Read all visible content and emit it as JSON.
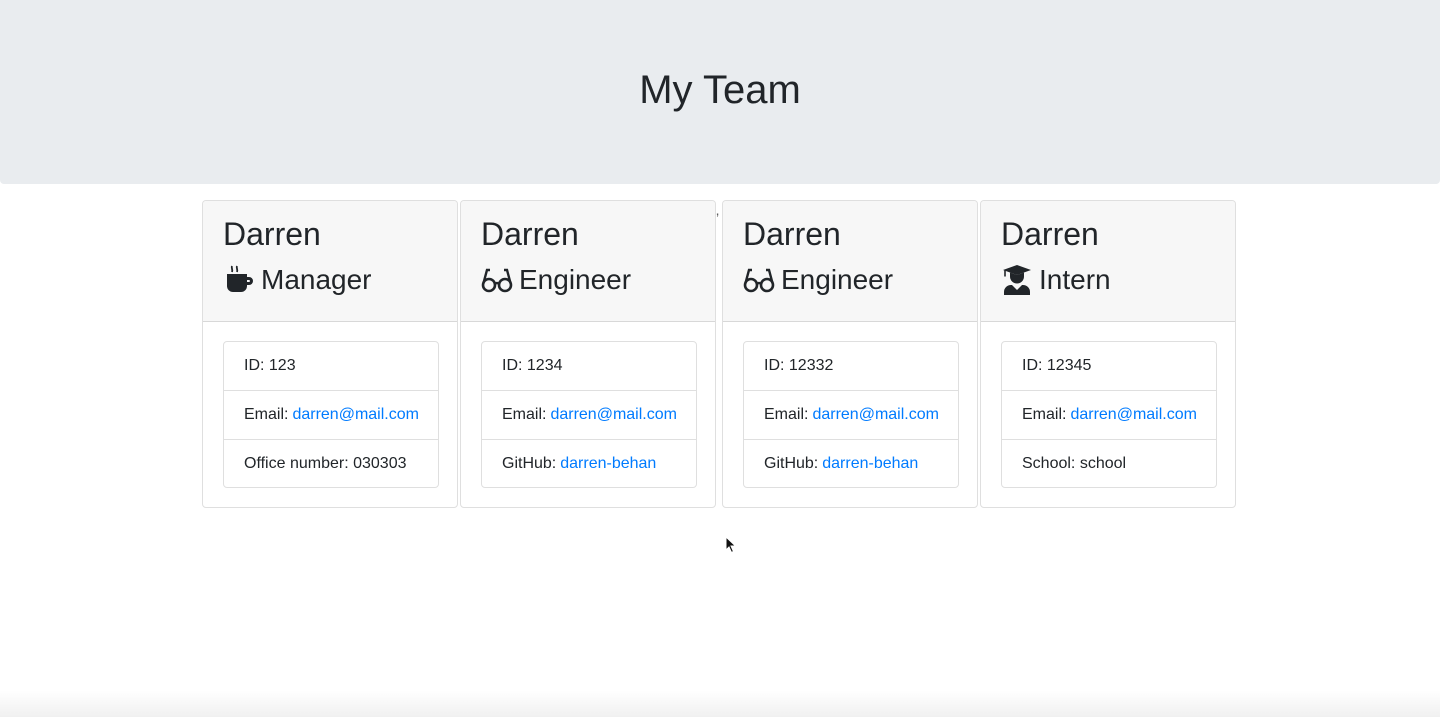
{
  "header": {
    "title": "My Team"
  },
  "cards": [
    {
      "name": "Darren",
      "role": "Manager",
      "icon": "coffee-mug-icon",
      "id_label": "ID:",
      "id": "123",
      "email_label": "Email:",
      "email": "darren@mail.com",
      "extra_label": "Office number:",
      "extra": "030303"
    },
    {
      "name": "Darren",
      "role": "Engineer",
      "icon": "glasses-icon",
      "id_label": "ID:",
      "id": "1234",
      "email_label": "Email:",
      "email": "darren@mail.com",
      "extra_label": "GitHub:",
      "extra": "darren-behan"
    },
    {
      "name": "Darren",
      "role": "Engineer",
      "icon": "glasses-icon",
      "id_label": "ID:",
      "id": "12332",
      "email_label": "Email:",
      "email": "darren@mail.com",
      "extra_label": "GitHub:",
      "extra": "darren-behan"
    },
    {
      "name": "Darren",
      "role": "Intern",
      "icon": "graduate-icon",
      "id_label": "ID:",
      "id": "12345",
      "email_label": "Email:",
      "email": "darren@mail.com",
      "extra_label": "School:",
      "extra": "school"
    }
  ],
  "colors": {
    "link": "#007bff",
    "jumbotron": "#e9ecef",
    "card_header": "#f7f7f7"
  }
}
